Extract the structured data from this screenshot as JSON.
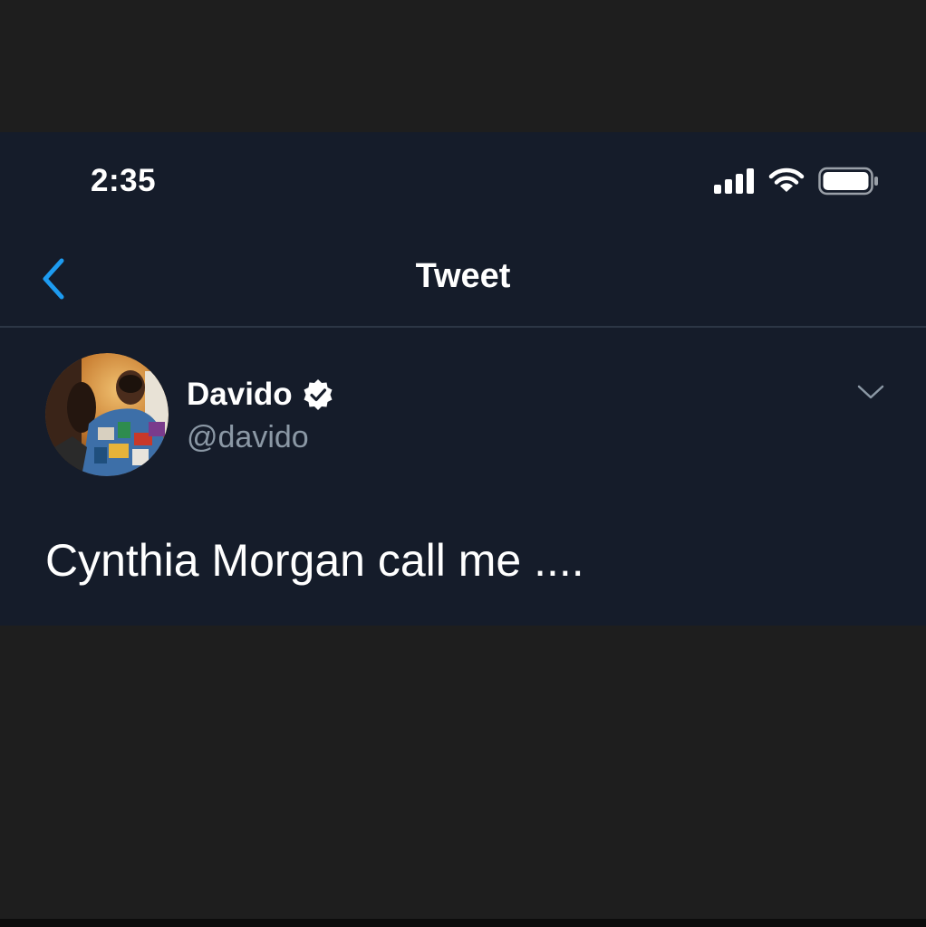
{
  "status_bar": {
    "time": "2:35",
    "icons": [
      "signal-icon",
      "wifi-icon",
      "battery-icon"
    ]
  },
  "nav": {
    "back_icon": "chevron-left-icon",
    "title": "Tweet"
  },
  "tweet": {
    "display_name": "Davido",
    "verified": true,
    "handle": "@davido",
    "text": "Cynthia Morgan call me ....",
    "menu_icon": "chevron-down-icon"
  },
  "colors": {
    "background": "#1e1e1e",
    "app_background": "#151c2a",
    "accent": "#1d9bf0",
    "secondary_text": "#8b98a5",
    "divider": "#2c3645"
  }
}
